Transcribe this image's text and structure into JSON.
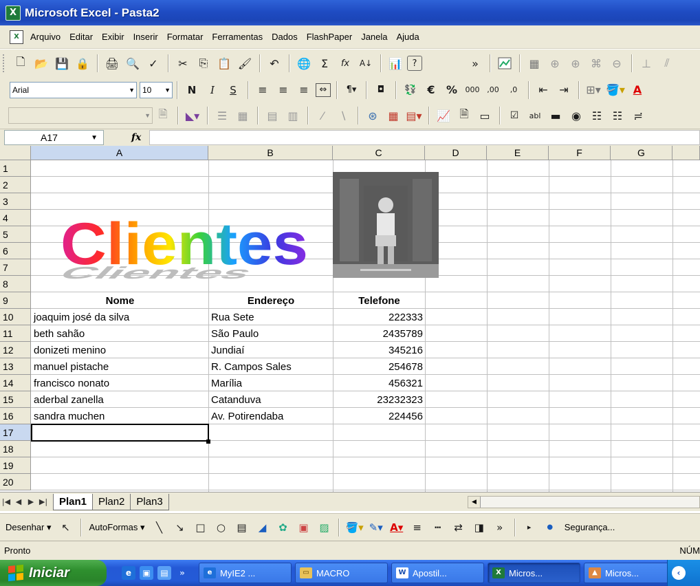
{
  "window": {
    "title": "Microsoft Excel - Pasta2",
    "app_icon": "X"
  },
  "menu": {
    "doc_icon": "X",
    "items": [
      "Arquivo",
      "Editar",
      "Exibir",
      "Inserir",
      "Formatar",
      "Ferramentas",
      "Dados",
      "FlashPaper",
      "Janela",
      "Ajuda"
    ]
  },
  "toolbar_standard": {
    "icons": [
      "new-icon",
      "open-icon",
      "save-icon",
      "permission-icon",
      "print-icon",
      "print-preview-icon",
      "spelling-icon",
      "cut-icon",
      "copy-icon",
      "paste-icon",
      "format-painter-icon",
      "undo-icon",
      "hyperlink-icon",
      "autosum-icon",
      "function-icon",
      "sort-ascending-icon",
      "chart-wizard-icon",
      "help-icon"
    ],
    "glyphs": {
      "new": "🗋",
      "open": "📂",
      "save": "💾",
      "permission": "🔒",
      "print": "🖨",
      "print_preview": "🔍",
      "spelling": "✓",
      "cut": "✂",
      "copy": "⎘",
      "paste": "📋",
      "format_painter": "🖌",
      "undo": "↶",
      "hyperlink": "🌐",
      "autosum": "Σ",
      "function": "fx",
      "sort": "A↓",
      "chart": "📊",
      "help": "?"
    },
    "overflow": "»"
  },
  "toolbar_formatting": {
    "font_name": "Arial",
    "font_size": "10",
    "bold": "N",
    "italic": "I",
    "underline": "S",
    "currency": "€",
    "percent": "%",
    "thousands": "000",
    "inc_decimal": ",00",
    "dec_decimal": ",0",
    "font_color_letter": "A"
  },
  "formula_bar": {
    "name_box": "A17",
    "fx": "fx",
    "value": ""
  },
  "sheet": {
    "columns": [
      "A",
      "B",
      "C",
      "D",
      "E",
      "F",
      "G"
    ],
    "rows": [
      "1",
      "2",
      "3",
      "4",
      "5",
      "6",
      "7",
      "8",
      "9",
      "10",
      "11",
      "12",
      "13",
      "14",
      "15",
      "16",
      "17",
      "18",
      "19",
      "20"
    ],
    "selected_column": "A",
    "selected_row": "17",
    "wordart_text": "Clientes",
    "headers": {
      "nome": "Nome",
      "endereco": "Endereço",
      "telefone": "Telefone"
    },
    "records": [
      {
        "nome": "joaquim josé da silva",
        "endereco": "Rua Sete",
        "telefone": "222333"
      },
      {
        "nome": "beth sahão",
        "endereco": "São Paulo",
        "telefone": "2435789"
      },
      {
        "nome": "donizeti menino",
        "endereco": "Jundiaí",
        "telefone": "345216"
      },
      {
        "nome": "manuel pistache",
        "endereco": "R. Campos Sales",
        "telefone": "254678"
      },
      {
        "nome": "francisco nonato",
        "endereco": "Marília",
        "telefone": "456321"
      },
      {
        "nome": "aderbal zanella",
        "endereco": "Catanduva",
        "telefone": "23232323"
      },
      {
        "nome": "sandra muchen",
        "endereco": "Av. Potirendaba",
        "telefone": "224456"
      }
    ]
  },
  "sheet_tabs": [
    "Plan1",
    "Plan2",
    "Plan3"
  ],
  "drawing_toolbar": {
    "draw": "Desenhar",
    "autoshapes": "AutoFormas",
    "security": "Segurança..."
  },
  "status": {
    "ready": "Pronto",
    "num": "NÚM"
  },
  "taskbar": {
    "start": "Iniciar",
    "buttons": [
      {
        "label": "MyIE2 ...",
        "active": false
      },
      {
        "label": "MACRO",
        "active": false
      },
      {
        "label": "Apostil...",
        "active": false
      },
      {
        "label": "Micros...",
        "active": true
      },
      {
        "label": "Micros...",
        "active": false
      }
    ]
  },
  "colors": {
    "titlebar": "#1f4cc3",
    "chrome": "#ece9d8",
    "selected_header": "#c9d9f0",
    "taskbar": "#245ad7",
    "start": "#2e8f2e"
  }
}
